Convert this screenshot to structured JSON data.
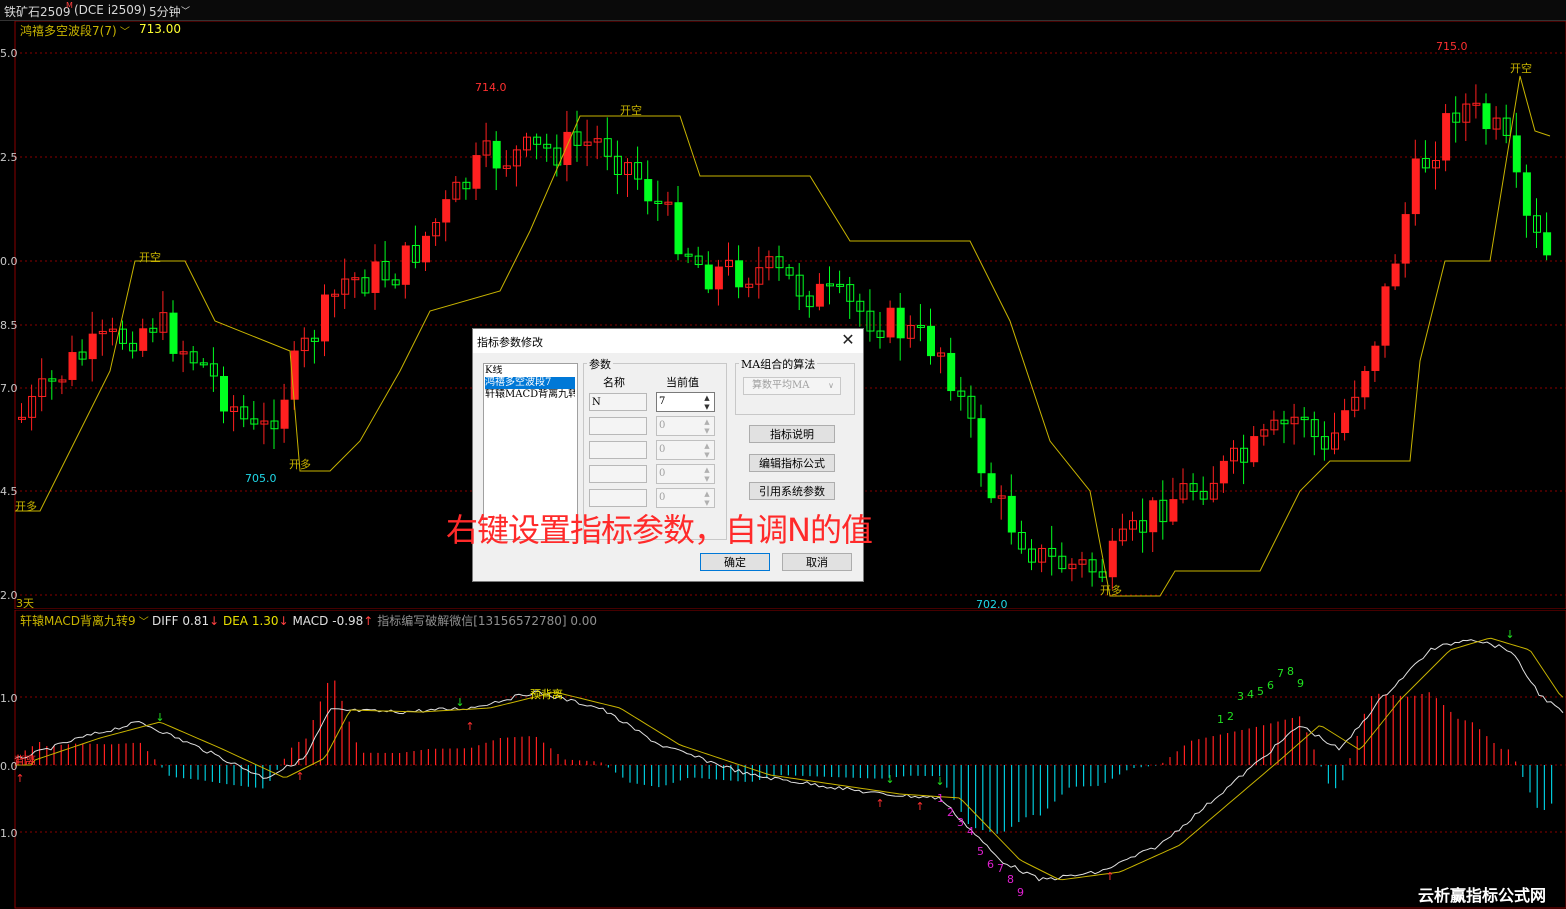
{
  "topbar": {
    "symbol": "铁矿石2509",
    "symbol_sup": "M",
    "exchange": "(DCE i2509)",
    "period": "5分钟"
  },
  "main_chart": {
    "indicator_name": "鸿禧多空波段7(7)",
    "indicator_value": "713.00",
    "y_axis_labels": [
      "5.0",
      "2.5",
      "0.0",
      "8.5",
      "7.0",
      "4.5",
      "2.0"
    ],
    "price_marks": [
      "714.0",
      "705.0",
      "715.0",
      "702.0"
    ],
    "signals": [
      "开空",
      "开空",
      "开空",
      "开多",
      "开多",
      "开多"
    ],
    "days_label": "3天"
  },
  "sub_chart": {
    "indicator_name": "轩辕MACD背离九转9",
    "diff": "DIFF 0.81",
    "dea": "DEA 1.30",
    "macd": "MACD -0.98",
    "extra": "指标编写破解微信[13156572780] 0.00",
    "y_axis_labels": [
      "1.0",
      "0.0",
      "1.0"
    ],
    "labels": [
      "背离",
      "预背离"
    ],
    "counts_green": [
      "1",
      "2",
      "3",
      "4",
      "5",
      "6",
      "7",
      "8",
      "9"
    ],
    "counts_pink": [
      "1",
      "2",
      "3",
      "4",
      "5",
      "6",
      "7",
      "8",
      "9"
    ]
  },
  "dialog": {
    "title": "指标参数修改",
    "list_items": [
      "K线",
      "鸿禧多空波段7",
      "轩辕MACD背离九转"
    ],
    "param_group": "参数",
    "col_name": "名称",
    "col_value": "当前值",
    "params": [
      {
        "name": "N",
        "value": "7"
      },
      {
        "name": "",
        "value": "0"
      },
      {
        "name": "",
        "value": "0"
      },
      {
        "name": "",
        "value": "0"
      },
      {
        "name": "",
        "value": "0"
      }
    ],
    "ma_group": "MA组合的算法",
    "ma_combo": "算数平均MA",
    "btn_help": "指标说明",
    "btn_edit": "编辑指标公式",
    "btn_ref": "引用系统参数",
    "btn_ok": "确定",
    "btn_cancel": "取消"
  },
  "overlay_text": "右键设置指标参数，自调N的值",
  "watermark": "云析赢指标公式网",
  "colors": {
    "up": "#ff2020",
    "down": "#00ff20",
    "band": "#c8b400",
    "cyan": "#00c8d8",
    "grid": "#8a0000"
  }
}
